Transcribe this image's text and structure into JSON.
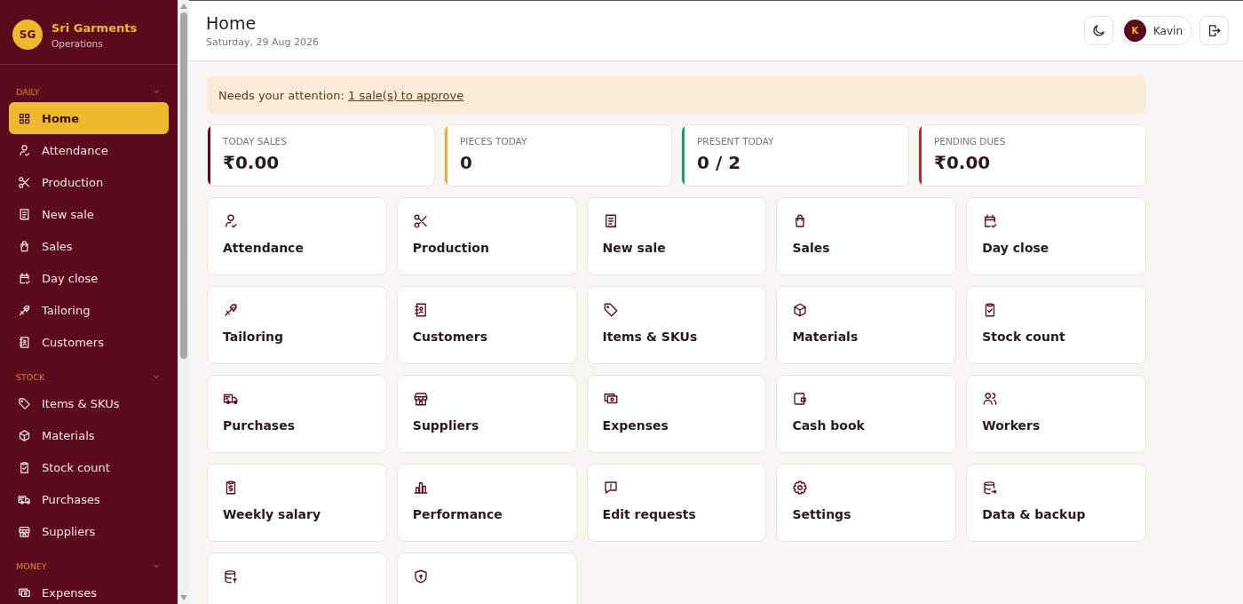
{
  "brand": {
    "initials": "SG",
    "name": "Sri Garments",
    "subtitle": "Operations"
  },
  "sidebar": {
    "groups": [
      {
        "label": "DAILY",
        "expanded": true,
        "items": [
          {
            "label": "Home",
            "kind": "grid",
            "selected": true
          },
          {
            "label": "Attendance",
            "kind": "usercheck",
            "selected": false
          },
          {
            "label": "Production",
            "kind": "scissors",
            "selected": false
          },
          {
            "label": "New sale",
            "kind": "receipt",
            "selected": false
          },
          {
            "label": "Sales",
            "kind": "bag",
            "selected": false
          },
          {
            "label": "Day close",
            "kind": "calendar",
            "selected": false
          },
          {
            "label": "Tailoring",
            "kind": "needle",
            "selected": false
          },
          {
            "label": "Customers",
            "kind": "contacts",
            "selected": false
          }
        ]
      },
      {
        "label": "STOCK",
        "expanded": true,
        "items": [
          {
            "label": "Items & SKUs",
            "kind": "tag",
            "selected": false
          },
          {
            "label": "Materials",
            "kind": "cube",
            "selected": false
          },
          {
            "label": "Stock count",
            "kind": "clipboard",
            "selected": false
          },
          {
            "label": "Purchases",
            "kind": "truck",
            "selected": false
          },
          {
            "label": "Suppliers",
            "kind": "store",
            "selected": false
          }
        ]
      },
      {
        "label": "MONEY",
        "expanded": true,
        "items": [
          {
            "label": "Expenses",
            "kind": "cash",
            "selected": false
          }
        ]
      }
    ]
  },
  "header": {
    "title": "Home",
    "date": "Saturday, 29 Aug 2026",
    "user": {
      "initial": "K",
      "name": "Kavin"
    }
  },
  "alert": {
    "text": "Needs your attention: ",
    "link": "1 sale(s) to approve"
  },
  "stats": [
    {
      "label": "TODAY SALES",
      "value": "₹0.00",
      "color": "#5c0b1f"
    },
    {
      "label": "PIECES TODAY",
      "value": "0",
      "color": "#e8b030"
    },
    {
      "label": "PRESENT TODAY",
      "value": "0 / 2",
      "color": "#1f9a6e"
    },
    {
      "label": "PENDING DUES",
      "value": "₹0.00",
      "color": "#a3322b"
    }
  ],
  "tiles": [
    {
      "label": "Attendance",
      "kind": "usercheck"
    },
    {
      "label": "Production",
      "kind": "scissors"
    },
    {
      "label": "New sale",
      "kind": "receipt"
    },
    {
      "label": "Sales",
      "kind": "bag"
    },
    {
      "label": "Day close",
      "kind": "calendar"
    },
    {
      "label": "Tailoring",
      "kind": "needle"
    },
    {
      "label": "Customers",
      "kind": "contacts"
    },
    {
      "label": "Items & SKUs",
      "kind": "tag"
    },
    {
      "label": "Materials",
      "kind": "cube"
    },
    {
      "label": "Stock count",
      "kind": "clipboard"
    },
    {
      "label": "Purchases",
      "kind": "truck"
    },
    {
      "label": "Suppliers",
      "kind": "store"
    },
    {
      "label": "Expenses",
      "kind": "cash"
    },
    {
      "label": "Cash book",
      "kind": "wallet"
    },
    {
      "label": "Workers",
      "kind": "people"
    },
    {
      "label": "Weekly salary",
      "kind": "salary"
    },
    {
      "label": "Performance",
      "kind": "chart"
    },
    {
      "label": "Edit requests",
      "kind": "message"
    },
    {
      "label": "Settings",
      "kind": "gear"
    },
    {
      "label": "Data & backup",
      "kind": "database"
    },
    {
      "kind": "upload"
    },
    {
      "kind": "shield"
    }
  ]
}
